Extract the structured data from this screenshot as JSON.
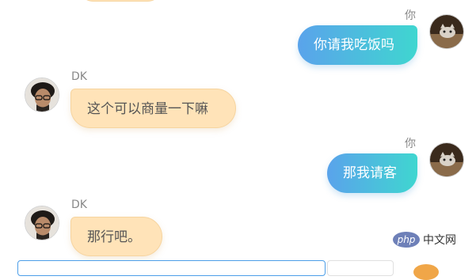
{
  "chat": {
    "top_bubble_partial": "",
    "messages": [
      {
        "sender": "你",
        "text": "你请我吃饭吗"
      },
      {
        "sender": "DK",
        "text": "这个可以商量一下嘛"
      },
      {
        "sender": "你",
        "text": "那我请客"
      },
      {
        "sender": "DK",
        "text": "那行吧。"
      }
    ]
  },
  "watermark": {
    "logo": "php",
    "text": "中文网"
  },
  "colors": {
    "me_bubble_start": "#5aa3eb",
    "me_bubble_end": "#3fd6d0",
    "dk_bubble": "#ffe3b8",
    "input_border": "#4c9ee8"
  }
}
